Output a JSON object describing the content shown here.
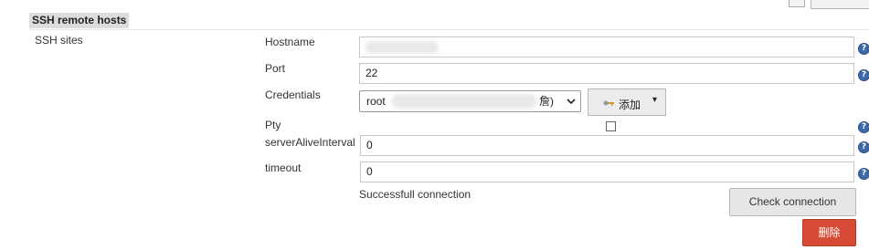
{
  "section": {
    "title": "SSH remote hosts"
  },
  "site": {
    "label": "SSH sites"
  },
  "fields": {
    "hostname": {
      "label": "Hostname",
      "value": ""
    },
    "port": {
      "label": "Port",
      "value": "22"
    },
    "credentials": {
      "label": "Credentials",
      "selected_prefix": "root",
      "selected_suffix": "詹)"
    },
    "pty": {
      "label": "Pty",
      "checked": false
    },
    "server_alive_interval": {
      "label": "serverAliveInterval",
      "value": "0"
    },
    "timeout": {
      "label": "timeout",
      "value": "0"
    }
  },
  "buttons": {
    "add": "添加",
    "check_connection": "Check connection",
    "delete": "删除"
  },
  "status": {
    "message": "Successfull connection"
  },
  "icons": {
    "help": "?",
    "dropdown": "▾",
    "key": "key-icon"
  },
  "colors": {
    "delete_bg": "#d64a36",
    "help_icon": "#3d6aa8",
    "header_bg": "#dcdcdc"
  }
}
